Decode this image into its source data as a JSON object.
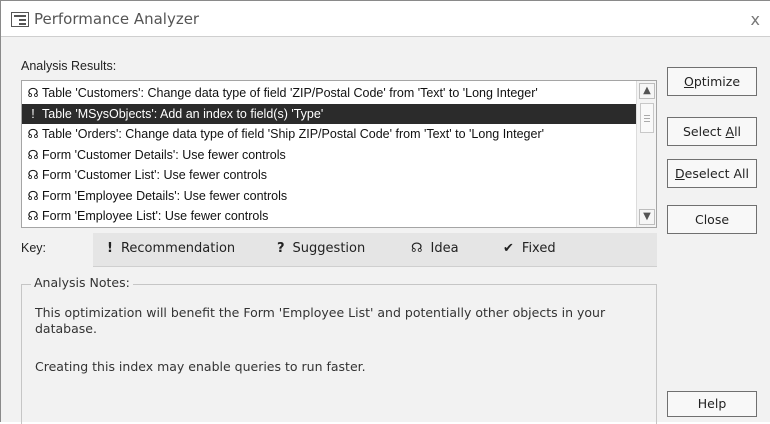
{
  "window": {
    "title": "Performance Analyzer",
    "close_glyph": "x",
    "icon": "table-icon"
  },
  "results_label": "Analysis Results:",
  "results": [
    {
      "icon": "idea-icon",
      "glyph": "☊",
      "text": "Table 'Customers': Change data type of field 'ZIP/Postal Code' from 'Text' to 'Long Integer'",
      "selected": false
    },
    {
      "icon": "recommendation-icon",
      "glyph": "!",
      "text": "Table 'MSysObjects': Add an index to field(s) 'Type'",
      "selected": true
    },
    {
      "icon": "idea-icon",
      "glyph": "☊",
      "text": "Table 'Orders': Change data type of field 'Ship ZIP/Postal Code' from 'Text' to 'Long Integer'",
      "selected": false
    },
    {
      "icon": "idea-icon",
      "glyph": "☊",
      "text": "Form 'Customer Details': Use fewer controls",
      "selected": false
    },
    {
      "icon": "idea-icon",
      "glyph": "☊",
      "text": "Form 'Customer List': Use fewer controls",
      "selected": false
    },
    {
      "icon": "idea-icon",
      "glyph": "☊",
      "text": "Form 'Employee Details': Use fewer controls",
      "selected": false
    },
    {
      "icon": "idea-icon",
      "glyph": "☊",
      "text": "Form 'Employee List': Use fewer controls",
      "selected": false
    }
  ],
  "key": {
    "label": "Key:",
    "items": [
      {
        "icon": "recommendation-icon",
        "glyph": "!",
        "label": "Recommendation"
      },
      {
        "icon": "suggestion-icon",
        "glyph": "?",
        "label": "Suggestion"
      },
      {
        "icon": "idea-icon",
        "glyph": "☊",
        "label": "Idea"
      },
      {
        "icon": "fixed-icon",
        "glyph": "✔",
        "label": "Fixed"
      }
    ]
  },
  "notes": {
    "label": "Analysis Notes:",
    "paragraph1_line1": "This optimization will benefit the Form 'Employee List' and potentially other objects in your",
    "paragraph1_line2": "database.",
    "paragraph2": "Creating this index may enable queries to run faster."
  },
  "buttons": {
    "optimize": {
      "pre": "",
      "u": "O",
      "post": "ptimize"
    },
    "select_all": {
      "pre": "Select ",
      "u": "A",
      "post": "ll"
    },
    "deselect_all": {
      "pre": "",
      "u": "D",
      "post": "eselect All"
    },
    "close": {
      "pre": "Close",
      "u": "",
      "post": ""
    },
    "help": {
      "pre": "Help",
      "u": "",
      "post": ""
    }
  },
  "scrollbar": {
    "up_glyph": "▲",
    "down_glyph": "▼"
  }
}
